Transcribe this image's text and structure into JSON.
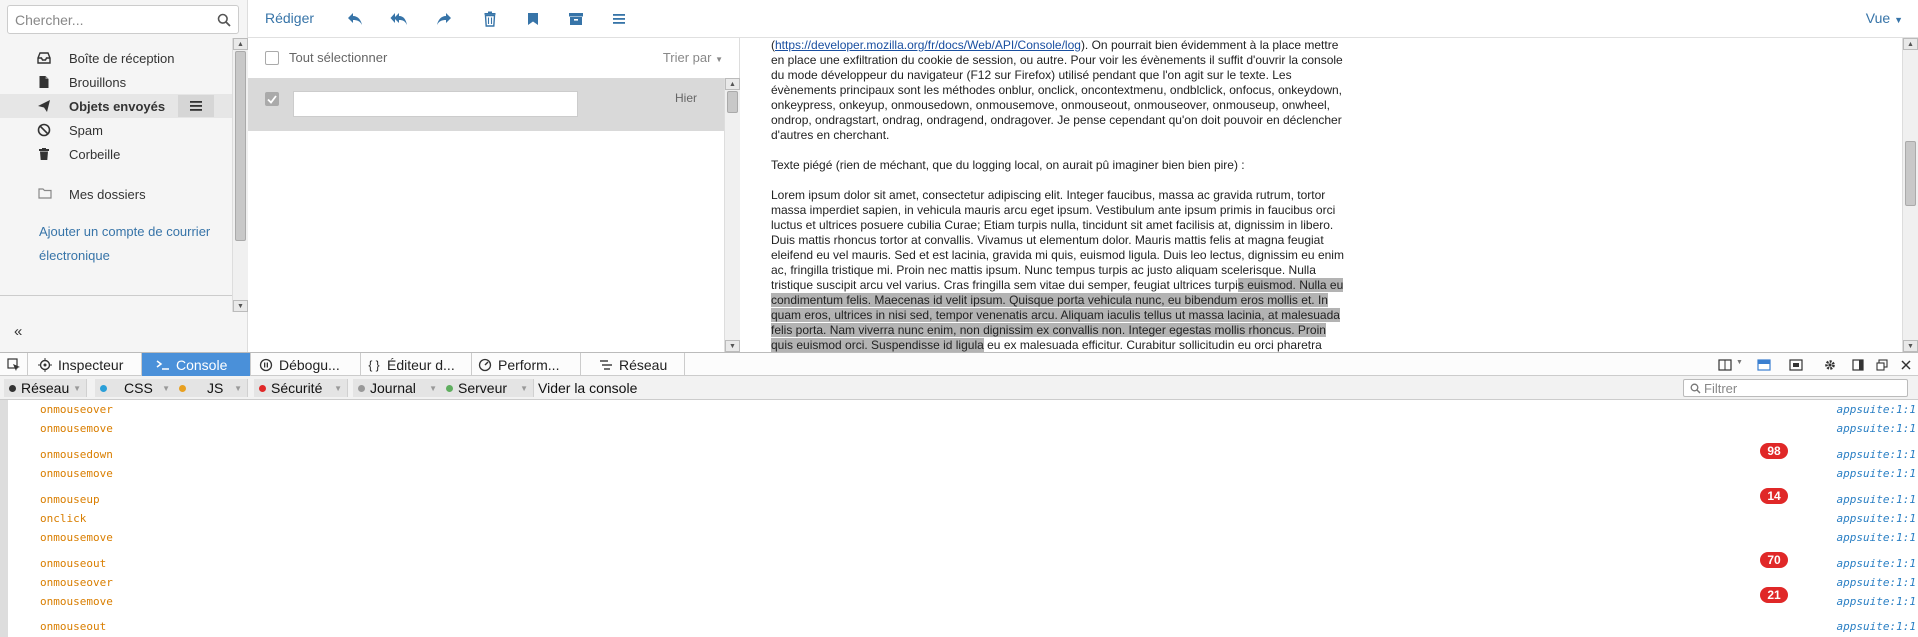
{
  "search": {
    "placeholder": "Chercher..."
  },
  "toolbar": {
    "compose_label": "Rédiger",
    "view_label": "Vue"
  },
  "folders": [
    {
      "label": "Boîte de réception",
      "icon": "inbox-icon"
    },
    {
      "label": "Brouillons",
      "icon": "draft-file-icon"
    },
    {
      "label": "Objets envoyés",
      "icon": "send-icon",
      "active": true
    },
    {
      "label": "Spam",
      "icon": "ban-icon"
    },
    {
      "label": "Corbeille",
      "icon": "trash-icon"
    }
  ],
  "my_folders_label": "Mes dossiers",
  "add_account_label": "Ajouter un compte de courrier électronique",
  "list": {
    "select_all_label": "Tout sélectionner",
    "sort_label": "Trier par",
    "rows": [
      {
        "date": "Hier"
      }
    ]
  },
  "mail": {
    "p1_link": "https://developer.mozilla.org/fr/docs/Web/API/Console/log",
    "p1_text": "). On pourrait bien évidemment à la place mettre en place une exfiltration du cookie de session, ou autre. Pour voir les évènements il suffit d'ouvrir la console du mode développeur du navigateur (F12 sur Firefox) utilisé pendant que l'on agit sur le texte. Les évènements principaux sont les méthodes onblur, onclick, oncontextmenu, ondblclick, onfocus, onkeydown, onkeypress, onkeyup, onmousedown, onmousemove, onmouseout, onmouseover, onmouseup, onwheel, ondrop, ondragstart, ondrag, ondragend, ondragover. Je pense cependant qu'on doit pouvoir en déclencher d'autres en cherchant.",
    "p2": "Texte piégé (rien de méchant, que du logging local, on aurait pû imaginer bien bien pire) :",
    "p3_before": "Lorem ipsum dolor sit amet, consectetur adipiscing elit. Integer faucibus, massa ac gravida rutrum, tortor massa imperdiet sapien, in vehicula mauris arcu eget ipsum. Vestibulum ante ipsum primis in faucibus orci luctus et ultrices posuere cubilia Curae; Etiam turpis nulla, tincidunt sit amet facilisis at, dignissim in libero. Duis mattis rhoncus tortor at convallis. Vivamus ut elementum dolor. Mauris mattis felis at magna feugiat eleifend eu vel mauris. Sed et est lacinia, gravida mi quis, euismod ligula. Duis leo lectus, dignissim eu enim ac, fringilla tristique mi. Proin nec mattis ipsum. Nunc tempus turpis ac justo aliquam scelerisque. Nulla tristique suscipit arcu vel varius. Cras fringilla sem vitae dui semper, feugiat ultrices turpi",
    "p3_highlight": "s euismod. Nulla eu condimentum felis. Maecenas id velit ipsum. Quisque porta vehicula nunc, eu bibendum eros mollis et. In quam eros, ultrices in nisi sed, tempor venenatis arcu. Aliquam iaculis tellus ut massa lacinia, at malesuada felis porta. Nam viverra nunc enim, non dignissim ex convallis non. Integer egestas mollis rhoncus. Proin quis euismod orci. Suspendisse id ligula",
    "p3_after": " eu ex malesuada efficitur. Curabitur sollicitudin eu orci pharetra finibus. Fusce tempor tincidunt neque at euismod. Nam vestibulum quam eget justo vulputate sodales. Sed sit amet commodo neque, nec mattis augue. Nam tincidunt odio non finibus congue. Aliquam ac elit a mi rutrum scelerisque sed"
  },
  "devtools": {
    "tabs": [
      {
        "label": "Inspecteur",
        "icon": "inspector-icon"
      },
      {
        "label": "Console",
        "icon": "console-icon",
        "active": true
      },
      {
        "label": "Débogu...",
        "icon": "debugger-icon"
      },
      {
        "label": "Éditeur d...",
        "icon": "style-editor-icon"
      },
      {
        "label": "Perform...",
        "icon": "performance-icon"
      },
      {
        "label": "Réseau",
        "icon": "network-icon"
      }
    ],
    "filters": [
      {
        "label": "Réseau",
        "color": "#333333"
      },
      {
        "label": "CSS",
        "color": "#2a9fd8"
      },
      {
        "label": "JS",
        "color": "#e8a020"
      },
      {
        "label": "Sécurité",
        "color": "#e02828"
      },
      {
        "label": "Journal",
        "color": "#999999"
      },
      {
        "label": "Serveur",
        "color": "#5fae5f"
      }
    ],
    "clear_label": "Vider la console",
    "filter_placeholder": "Filtrer"
  },
  "console_rows": [
    {
      "msg": "onmouseover",
      "count": "",
      "src": "appsuite:1:1"
    },
    {
      "msg": "onmousemove",
      "count": "98",
      "src": "appsuite:1:1"
    },
    {
      "msg": "onmousedown",
      "count": "",
      "src": "appsuite:1:1"
    },
    {
      "msg": "onmousemove",
      "count": "14",
      "src": "appsuite:1:1"
    },
    {
      "msg": "onmouseup",
      "count": "",
      "src": "appsuite:1:1"
    },
    {
      "msg": "onclick",
      "count": "",
      "src": "appsuite:1:1"
    },
    {
      "msg": "onmousemove",
      "count": "70",
      "src": "appsuite:1:1"
    },
    {
      "msg": "onmouseout",
      "count": "",
      "src": "appsuite:1:1"
    },
    {
      "msg": "onmouseover",
      "count": "",
      "src": "appsuite:1:1"
    },
    {
      "msg": "onmousemove",
      "count": "21",
      "src": "appsuite:1:1"
    },
    {
      "msg": "onmouseout",
      "count": "",
      "src": "appsuite:1:1"
    }
  ],
  "colors": {
    "accent": "#3774a8",
    "console_active": "#4a90d9",
    "log_text": "#d97e00",
    "badge": "#e02828",
    "source_link": "#2a7fc4"
  }
}
